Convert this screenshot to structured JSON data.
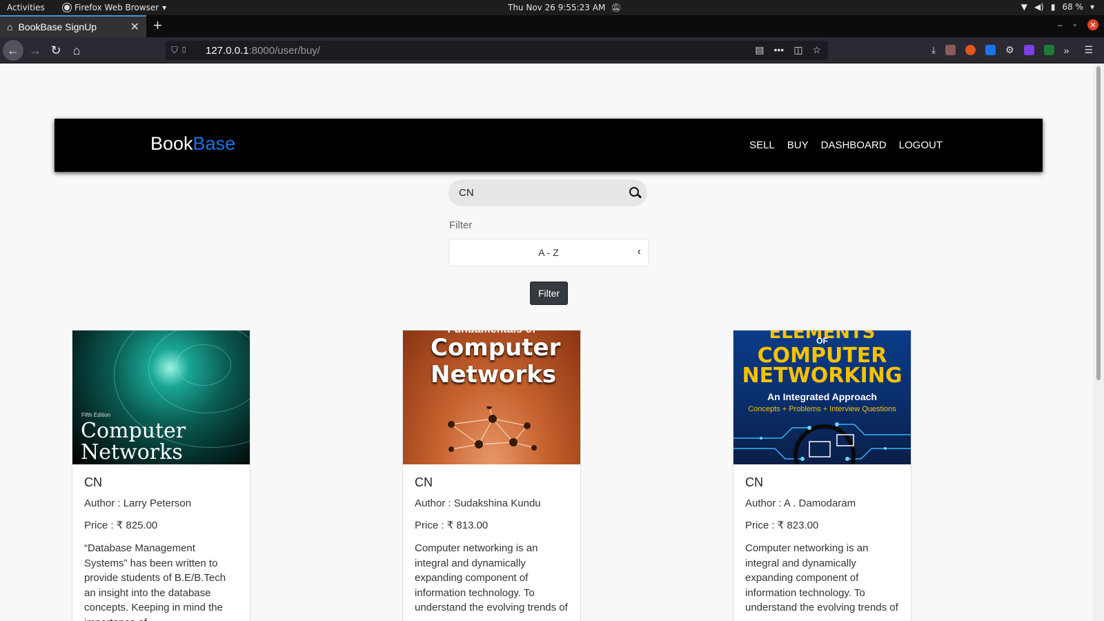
{
  "system": {
    "activities": "Activities",
    "app_name": "Firefox Web Browser",
    "clock": "Thu Nov 26   9:55:23 AM",
    "battery": "68 %"
  },
  "browser": {
    "tab_title": "BookBase SignUp",
    "url_host": "127.0.0.1",
    "url_rest": ":8000/user/buy/"
  },
  "site": {
    "brand_part1": "Book",
    "brand_part2": "Base",
    "nav": [
      "SELL",
      "BUY",
      "DASHBOARD",
      "LOGOUT"
    ],
    "colors": {
      "brand_accent": "#1a73e8",
      "header_bg": "#000000",
      "filter_button": "#343a40"
    }
  },
  "search": {
    "value": "CN"
  },
  "filter": {
    "label": "Filter",
    "selected": "A - Z",
    "button_label": "Filter"
  },
  "books": [
    {
      "cover_edition": "Fifth Edition",
      "cover_title": "Computer Networks",
      "title": "CN",
      "author_line": "Author : Larry Peterson",
      "price_line": "Price : ₹ 825.00",
      "description": "“Database Management Systems” has been written to provide students of B.E/B.Tech an insight into the database concepts. Keeping in mind the importance of"
    },
    {
      "cover_pre": "Fundamentals of",
      "cover_title": "Computer Networks",
      "title": "CN",
      "author_line": "Author : Sudakshina Kundu",
      "price_line": "Price : ₹ 813.00",
      "description": "Computer networking is an integral and dynamically expanding component of information technology. To understand the evolving trends of"
    },
    {
      "cover_title_top": "ELEMENTS",
      "cover_of": "OF",
      "cover_title": "COMPUTER NETWORKING",
      "cover_subtitle": "An Integrated Approach",
      "cover_tagline": "Concepts + Problems + Interview Questions",
      "title": "CN",
      "author_line": "Author : A . Damodaram",
      "price_line": "Price : ₹ 823.00",
      "description": "Computer networking is an integral and dynamically expanding component of information technology. To understand the evolving trends of"
    }
  ]
}
